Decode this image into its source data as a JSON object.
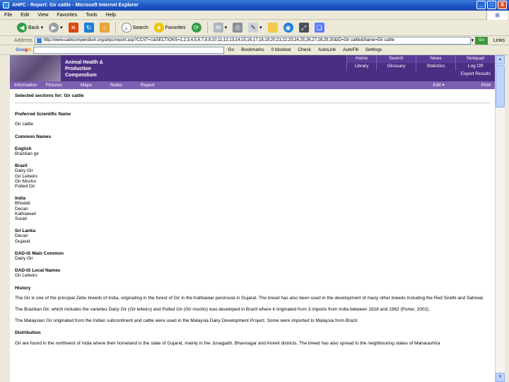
{
  "window": {
    "title": "AHPC - Report: Gir cattle - Microsoft Internet Explorer",
    "buttons": {
      "minimize": "_",
      "maximize": "□",
      "close": "X"
    }
  },
  "menubar": [
    "File",
    "Edit",
    "View",
    "Favorites",
    "Tools",
    "Help"
  ],
  "toolbar": {
    "back": "Back",
    "search": "Search",
    "favorites": "Favorites"
  },
  "addressbar": {
    "label": "Address",
    "url": "http://www.cabicompendium.org/ahpc/report.asp?CCST=1&SECTIONS=1,2,3,4,5,6,7,8,9,10,11,12,13,14,15,16,17,18,19,20,21,22,23,24,25,26,27,28,29,30&ID=Gir cattle&Name=Gir cattle",
    "go": "Go",
    "links": "Links"
  },
  "googlebar": {
    "logo_g1": "Goo",
    "logo_g2": "g",
    "logo_g3": "le",
    "go": "Go",
    "bookmarks": "Bookmarks",
    "blocked": "0 blocked",
    "check": "Check",
    "autolink": "AutoLink",
    "autofill": "AutoFill",
    "settings": "Settings"
  },
  "site": {
    "title_line1": "Animal Health &",
    "title_line2": "Production",
    "title_line3": "Compendium",
    "nav_row1": [
      "Home",
      "Search",
      "News",
      "Notepad"
    ],
    "nav_row2": [
      "",
      "Library",
      "Glossary",
      "Statistics",
      "Log Off"
    ],
    "nav_row3": "Export Results",
    "pnav_left": [
      "Information",
      "Pictures",
      "Maps",
      "Notes",
      "Report"
    ],
    "pnav_right": [
      "Edit",
      "Print"
    ]
  },
  "doc": {
    "selected": "Selected sections for: Gir cattle",
    "preferred_head": "Preferred Scientific Name",
    "preferred_value": "Gir cattle",
    "common_head": "Common Names",
    "english_label": "English",
    "english_value": "Brazilian gir",
    "brazil_label": "Brazil",
    "brazil_values": [
      "Dairy Gir",
      "Gir Leiteiro",
      "Gir Mocho",
      "Polled Gir"
    ],
    "india_label": "India",
    "india_values": [
      "Bhodali",
      "Decan",
      "Kathiawari",
      "Surati"
    ],
    "srilanka_label": "Sri Lanka",
    "srilanka_values": [
      "Decan",
      "Gujarat"
    ],
    "dadis_main_label": "DAD-IS Main Common",
    "dadis_main_value": "Dairy Gir",
    "dadis_local_label": "DAD-IS Local Names",
    "dadis_local_value": "Gir Leiteiro",
    "history_head": "History",
    "history_p1": "The Gir is one of the principal Zebu breeds of India, originating in the forest of Gir in the Kathiawar peninsula in Gujarat. The breed has also been used in the development of many other breeds including the Red Sindhi and Sahiwal.",
    "history_p2": "The Brazilian Gir, which includes the varieties Dairy Gir (Gir leiteiro) and Polled Gir (Gir mocho) was developed in Brazil where it originated from 3 imports from India between 1918 and 1962 (Porter, 2002).",
    "history_p3": "The Malaysian Gir originated from the Indian subcontinent and cattle were used in the Malaysia Dairy Development Project. Some were imported to Malaysia from Brazil.",
    "distribution_head": "Distribution",
    "distribution_p1": "Gir are found in the northwest of India where their homeland is the state of Gujarat, mainly in the Junagadh, Bhavnagar and Amreli districts. The breed has also spread to the neighbouring states of Maharashtra"
  }
}
